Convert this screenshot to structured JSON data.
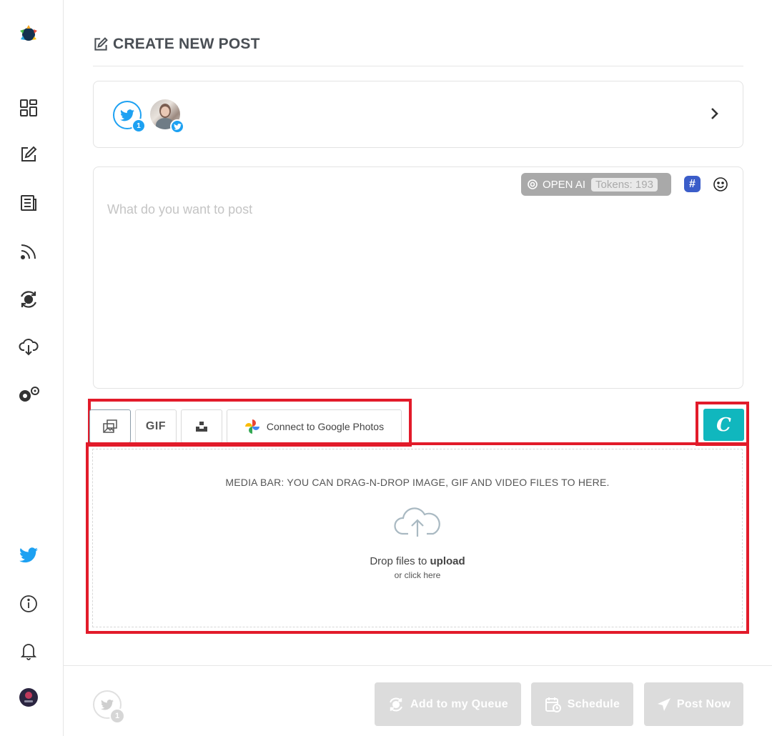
{
  "page": {
    "title": "CREATE NEW POST"
  },
  "sidebar": {
    "items": [
      {
        "name": "logo",
        "icon": "logo-icon"
      },
      {
        "name": "dashboard",
        "icon": "dashboard-icon"
      },
      {
        "name": "create-post",
        "icon": "edit-icon"
      },
      {
        "name": "posts",
        "icon": "document-icon"
      },
      {
        "name": "rss",
        "icon": "rss-icon"
      },
      {
        "name": "queue",
        "icon": "recycle-icon"
      },
      {
        "name": "cloud",
        "icon": "cloud-download-icon"
      },
      {
        "name": "settings",
        "icon": "gears-icon"
      }
    ],
    "bottom": [
      {
        "name": "twitter",
        "icon": "twitter-icon"
      },
      {
        "name": "info",
        "icon": "info-icon"
      },
      {
        "name": "notifications",
        "icon": "bell-icon"
      },
      {
        "name": "profile",
        "icon": "avatar"
      }
    ]
  },
  "accounts": {
    "selected_count": "1"
  },
  "composer": {
    "placeholder": "What do you want to post",
    "openai_label": "OPEN AI",
    "tokens_label": "Tokens: 193",
    "hashtag_label": "#"
  },
  "media_tools": {
    "gif_label": "GIF",
    "google_photos_label": "Connect to Google Photos",
    "canva_label": "C"
  },
  "dropzone": {
    "heading": "MEDIA BAR: YOU CAN DRAG-N-DROP IMAGE, GIF AND VIDEO FILES TO HERE.",
    "main_prefix": "Drop files to ",
    "main_bold": "upload",
    "sub": "or click here"
  },
  "footer": {
    "account_count": "1",
    "queue_label": "Add to my Queue",
    "schedule_label": "Schedule",
    "post_label": "Post Now"
  },
  "colors": {
    "twitter": "#1da1f2",
    "highlight": "#e21b2a",
    "canva": "#10b7be",
    "hashtag": "#3b5dc9",
    "disabled_button": "#dcdcdc"
  }
}
